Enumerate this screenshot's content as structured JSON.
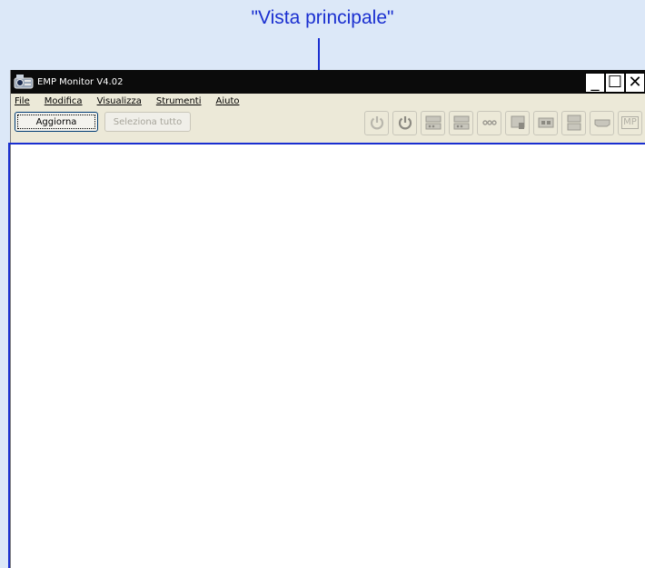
{
  "callout": {
    "label": "\"Vista principale\""
  },
  "window": {
    "title": "EMP Monitor V4.02"
  },
  "window_controls": {
    "minimize": "_",
    "maximize": "☐",
    "close": "✕"
  },
  "menu": [
    {
      "first": "F",
      "rest": "ile"
    },
    {
      "first": "M",
      "rest": "odifica"
    },
    {
      "first": "V",
      "rest": "isualizza"
    },
    {
      "first": "S",
      "rest": "trumenti"
    },
    {
      "first": "A",
      "rest": "iuto"
    }
  ],
  "toolbar": {
    "refresh_label": "Aggiorna",
    "select_all_label": "Seleziona tutto",
    "icons": [
      "power-off-disabled-icon",
      "power-on-icon",
      "input-source-1-icon",
      "input-source-2-icon",
      "video-icon",
      "s-video-icon",
      "component-icon",
      "computer-icon",
      "hdmi-icon",
      "mp-icon"
    ],
    "mp_label": "MP"
  },
  "colors": {
    "callout": "#1a2fd0",
    "titlebar": "#0b0b0b",
    "background": "#dce8f8"
  }
}
